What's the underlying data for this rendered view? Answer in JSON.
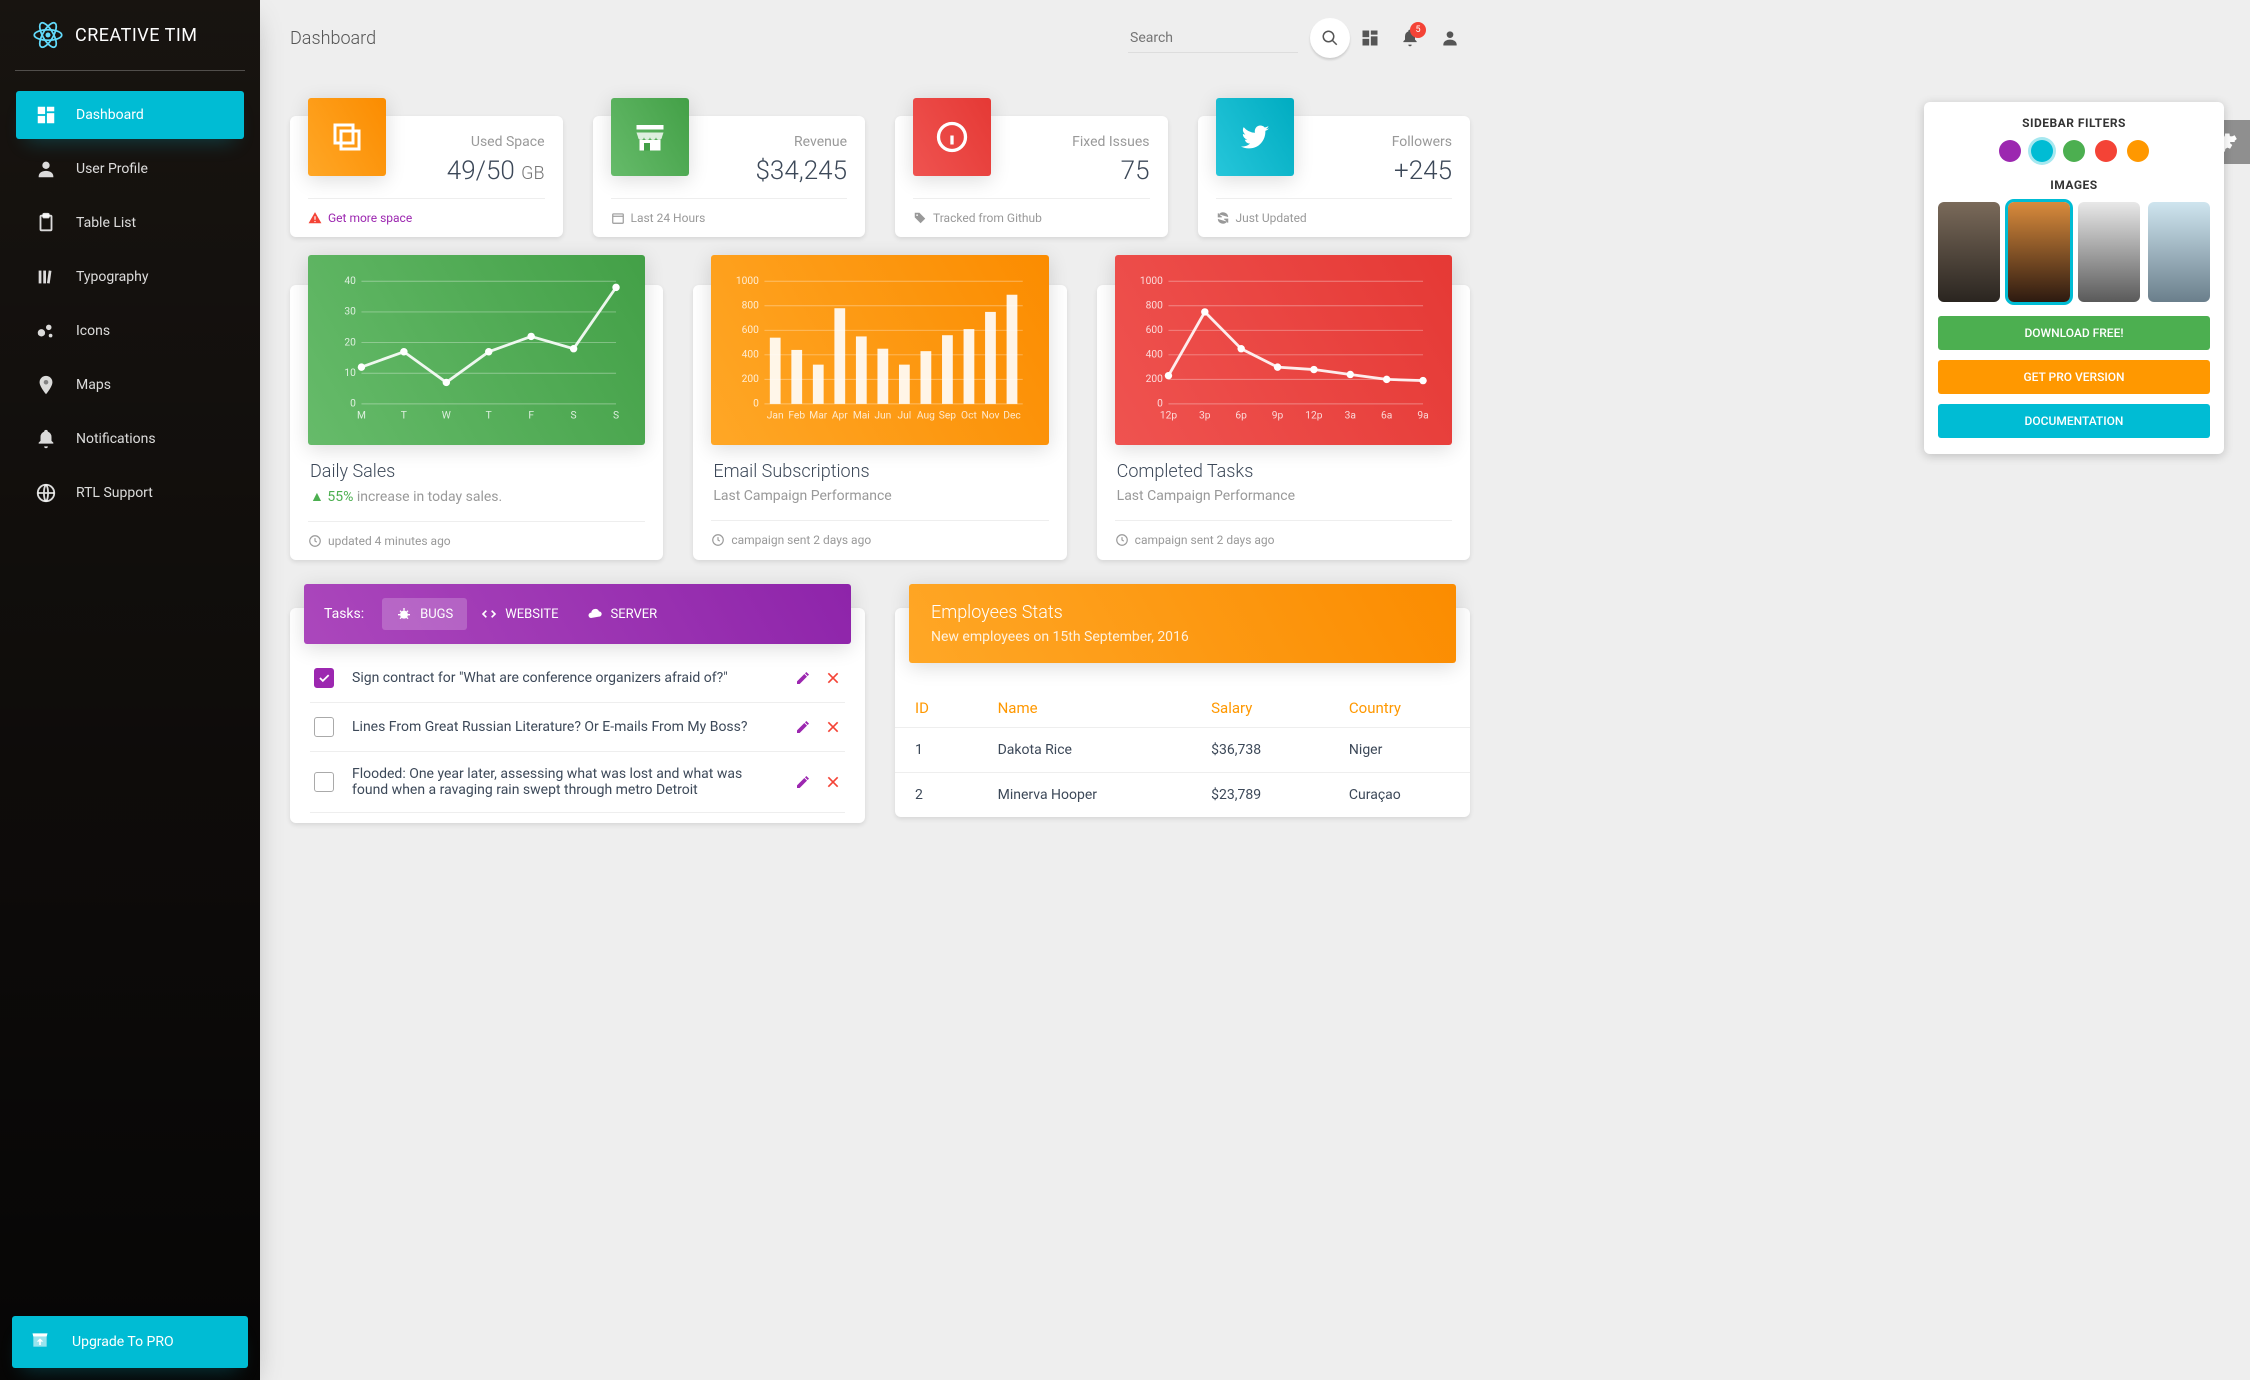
{
  "brand": "CREATIVE TIM",
  "page_title": "Dashboard",
  "search_placeholder": "Search",
  "notification_count": "5",
  "sidebar": {
    "items": [
      {
        "label": "Dashboard"
      },
      {
        "label": "User Profile"
      },
      {
        "label": "Table List"
      },
      {
        "label": "Typography"
      },
      {
        "label": "Icons"
      },
      {
        "label": "Maps"
      },
      {
        "label": "Notifications"
      },
      {
        "label": "RTL Support"
      }
    ],
    "upgrade_label": "Upgrade To PRO"
  },
  "stats": [
    {
      "label": "Used Space",
      "value": "49/50",
      "unit": "GB",
      "footer_link": "Get more space"
    },
    {
      "label": "Revenue",
      "value": "$34,245",
      "footer": "Last 24 Hours"
    },
    {
      "label": "Fixed Issues",
      "value": "75",
      "footer": "Tracked from Github"
    },
    {
      "label": "Followers",
      "value": "+245",
      "footer": "Just Updated"
    }
  ],
  "charts": {
    "daily_sales": {
      "title": "Daily Sales",
      "increase_pct": "55%",
      "increase_text": " increase in today sales.",
      "footer": "updated 4 minutes ago"
    },
    "emails": {
      "title": "Email Subscriptions",
      "sub": "Last Campaign Performance",
      "footer": "campaign sent 2 days ago"
    },
    "completed": {
      "title": "Completed Tasks",
      "sub": "Last Campaign Performance",
      "footer": "campaign sent 2 days ago"
    }
  },
  "tasks": {
    "heading": "Tasks:",
    "tabs": [
      {
        "label": "BUGS"
      },
      {
        "label": "WEBSITE"
      },
      {
        "label": "SERVER"
      }
    ],
    "items": [
      {
        "text": "Sign contract for \"What are conference organizers afraid of?\"",
        "checked": true
      },
      {
        "text": "Lines From Great Russian Literature? Or E-mails From My Boss?",
        "checked": false
      },
      {
        "text": "Flooded: One year later, assessing what was lost and what was found when a ravaging rain swept through metro Detroit",
        "checked": false
      }
    ]
  },
  "employees": {
    "title": "Employees Stats",
    "sub": "New employees on 15th September, 2016",
    "columns": [
      "ID",
      "Name",
      "Salary",
      "Country"
    ],
    "rows": [
      {
        "id": "1",
        "name": "Dakota Rice",
        "salary": "$36,738",
        "country": "Niger"
      },
      {
        "id": "2",
        "name": "Minerva Hooper",
        "salary": "$23,789",
        "country": "Curaçao"
      }
    ]
  },
  "config": {
    "filters_title": "SIDEBAR FILTERS",
    "images_title": "IMAGES",
    "buttons": [
      "DOWNLOAD FREE!",
      "GET PRO VERSION",
      "DOCUMENTATION"
    ]
  },
  "chart_data": [
    {
      "type": "line",
      "title": "Daily Sales",
      "categories": [
        "M",
        "T",
        "W",
        "T",
        "F",
        "S",
        "S"
      ],
      "values": [
        12,
        17,
        7,
        17,
        22,
        18,
        38
      ],
      "ylim": [
        0,
        40
      ],
      "yticks": [
        0,
        10,
        20,
        30,
        40
      ]
    },
    {
      "type": "bar",
      "title": "Email Subscriptions",
      "categories": [
        "Jan",
        "Feb",
        "Mar",
        "Apr",
        "Mai",
        "Jun",
        "Jul",
        "Aug",
        "Sep",
        "Oct",
        "Nov",
        "Dec"
      ],
      "values": [
        540,
        440,
        320,
        780,
        550,
        450,
        320,
        430,
        560,
        610,
        750,
        890
      ],
      "ylim": [
        0,
        1000
      ],
      "yticks": [
        0,
        200,
        400,
        600,
        800,
        1000
      ]
    },
    {
      "type": "line",
      "title": "Completed Tasks",
      "categories": [
        "12p",
        "3p",
        "6p",
        "9p",
        "12p",
        "3a",
        "6a",
        "9a"
      ],
      "values": [
        230,
        750,
        450,
        300,
        280,
        240,
        200,
        190
      ],
      "ylim": [
        0,
        1000
      ],
      "yticks": [
        0,
        200,
        400,
        600,
        800,
        1000
      ]
    }
  ]
}
